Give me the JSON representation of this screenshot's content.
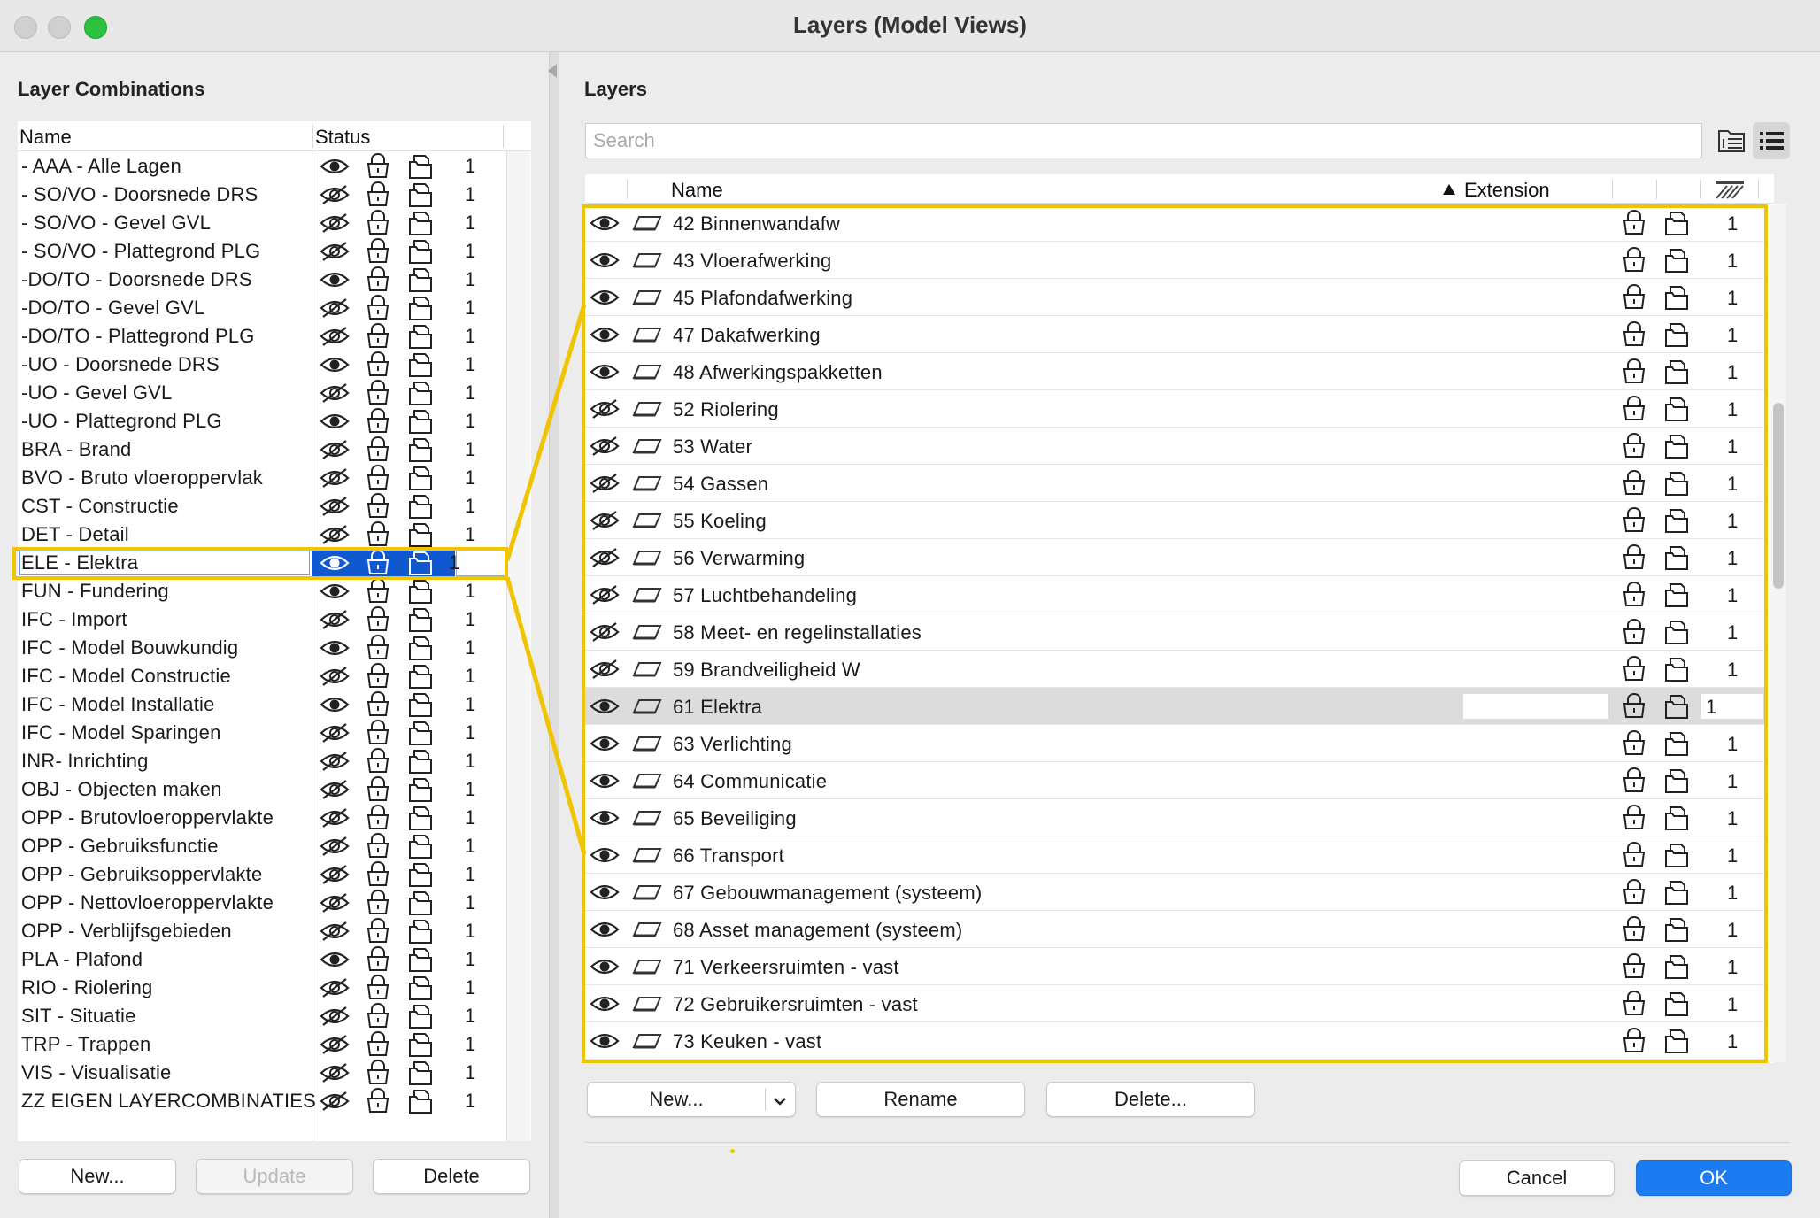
{
  "window": {
    "title": "Layers (Model Views)"
  },
  "left": {
    "section_title": "Layer Combinations",
    "col_name": "Name",
    "col_status": "Status",
    "rows": [
      {
        "name": "- AAA - Alle Lagen",
        "visible": true,
        "num": "1"
      },
      {
        "name": "- SO/VO - Doorsnede DRS",
        "visible": false,
        "num": "1"
      },
      {
        "name": "- SO/VO - Gevel GVL",
        "visible": false,
        "num": "1"
      },
      {
        "name": "- SO/VO - Plattegrond PLG",
        "visible": false,
        "num": "1"
      },
      {
        "name": "-DO/TO - Doorsnede DRS",
        "visible": true,
        "num": "1"
      },
      {
        "name": "-DO/TO - Gevel GVL",
        "visible": false,
        "num": "1"
      },
      {
        "name": "-DO/TO - Plattegrond PLG",
        "visible": false,
        "num": "1"
      },
      {
        "name": "-UO - Doorsnede DRS",
        "visible": true,
        "num": "1"
      },
      {
        "name": "-UO - Gevel GVL",
        "visible": false,
        "num": "1"
      },
      {
        "name": "-UO - Plattegrond PLG",
        "visible": true,
        "num": "1"
      },
      {
        "name": "BRA - Brand",
        "visible": false,
        "num": "1"
      },
      {
        "name": "BVO - Bruto vloeroppervlak",
        "visible": false,
        "num": "1"
      },
      {
        "name": "CST - Constructie",
        "visible": false,
        "num": "1"
      },
      {
        "name": "DET - Detail",
        "visible": false,
        "num": "1"
      },
      {
        "name": "ELE - Elektra",
        "visible": true,
        "num": "1",
        "selected": true
      },
      {
        "name": "FUN - Fundering",
        "visible": true,
        "num": "1"
      },
      {
        "name": "IFC - Import",
        "visible": false,
        "num": "1"
      },
      {
        "name": "IFC - Model Bouwkundig",
        "visible": true,
        "num": "1"
      },
      {
        "name": "IFC - Model Constructie",
        "visible": false,
        "num": "1"
      },
      {
        "name": "IFC - Model Installatie",
        "visible": true,
        "num": "1"
      },
      {
        "name": "IFC - Model Sparingen",
        "visible": false,
        "num": "1"
      },
      {
        "name": "INR- Inrichting",
        "visible": false,
        "num": "1"
      },
      {
        "name": "OBJ - Objecten maken",
        "visible": false,
        "num": "1"
      },
      {
        "name": "OPP - Brutovloeroppervlakte",
        "visible": false,
        "num": "1"
      },
      {
        "name": "OPP - Gebruiksfunctie",
        "visible": false,
        "num": "1"
      },
      {
        "name": "OPP - Gebruiksoppervlakte",
        "visible": false,
        "num": "1"
      },
      {
        "name": "OPP - Nettovloeroppervlakte",
        "visible": false,
        "num": "1"
      },
      {
        "name": "OPP - Verblijfsgebieden",
        "visible": false,
        "num": "1"
      },
      {
        "name": "PLA - Plafond",
        "visible": true,
        "num": "1"
      },
      {
        "name": "RIO - Riolering",
        "visible": false,
        "num": "1"
      },
      {
        "name": "SIT - Situatie",
        "visible": false,
        "num": "1"
      },
      {
        "name": "TRP - Trappen",
        "visible": false,
        "num": "1"
      },
      {
        "name": "VIS - Visualisatie",
        "visible": false,
        "num": "1"
      },
      {
        "name": "ZZ EIGEN LAYERCOMBINATIES",
        "visible": false,
        "num": "1"
      }
    ],
    "buttons": {
      "new": "New...",
      "update": "Update",
      "delete": "Delete"
    }
  },
  "right": {
    "section_title": "Layers",
    "search_placeholder": "Search",
    "col_name": "Name",
    "col_extension": "Extension",
    "rows": [
      {
        "name": "42 Binnenwandafw",
        "visible": true,
        "num": "1"
      },
      {
        "name": "43 Vloerafwerking",
        "visible": true,
        "num": "1"
      },
      {
        "name": "45 Plafondafwerking",
        "visible": true,
        "num": "1"
      },
      {
        "name": "47 Dakafwerking",
        "visible": true,
        "num": "1"
      },
      {
        "name": "48 Afwerkingspakketten",
        "visible": true,
        "num": "1"
      },
      {
        "name": "52 Riolering",
        "visible": false,
        "num": "1"
      },
      {
        "name": "53 Water",
        "visible": false,
        "num": "1"
      },
      {
        "name": "54 Gassen",
        "visible": false,
        "num": "1"
      },
      {
        "name": "55 Koeling",
        "visible": false,
        "num": "1"
      },
      {
        "name": "56 Verwarming",
        "visible": false,
        "num": "1"
      },
      {
        "name": "57 Luchtbehandeling",
        "visible": false,
        "num": "1"
      },
      {
        "name": "58 Meet- en regelinstallaties",
        "visible": false,
        "num": "1"
      },
      {
        "name": "59 Brandveiligheid W",
        "visible": false,
        "num": "1"
      },
      {
        "name": "61 Elektra",
        "visible": true,
        "num": "1",
        "highlighted": true
      },
      {
        "name": "63 Verlichting",
        "visible": true,
        "num": "1"
      },
      {
        "name": "64 Communicatie",
        "visible": true,
        "num": "1"
      },
      {
        "name": "65 Beveiliging",
        "visible": true,
        "num": "1"
      },
      {
        "name": "66 Transport",
        "visible": true,
        "num": "1"
      },
      {
        "name": "67 Gebouwmanagement (systeem)",
        "visible": true,
        "num": "1"
      },
      {
        "name": "68 Asset management (systeem)",
        "visible": true,
        "num": "1"
      },
      {
        "name": "71 Verkeersruimten - vast",
        "visible": true,
        "num": "1"
      },
      {
        "name": "72 Gebruikersruimten - vast",
        "visible": true,
        "num": "1"
      },
      {
        "name": "73 Keuken - vast",
        "visible": true,
        "num": "1"
      }
    ],
    "buttons": {
      "new": "New...",
      "rename": "Rename",
      "delete": "Delete...",
      "cancel": "Cancel",
      "ok": "OK"
    }
  },
  "colors": {
    "accent": "#1a7cf0",
    "selection": "#1058d0",
    "annotation": "#f0c400"
  }
}
